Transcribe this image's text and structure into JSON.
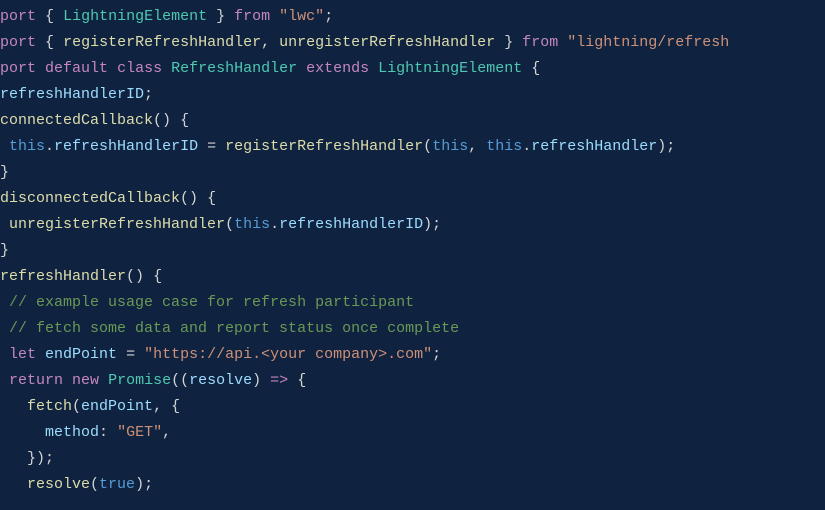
{
  "kw": {
    "import": "port",
    "from": "from",
    "default": "default",
    "class": "class",
    "extends": "extends",
    "let": "let",
    "return": "return",
    "new": "new"
  },
  "types": {
    "LightningElement": "LightningElement",
    "RefreshHandler": "RefreshHandler",
    "Promise": "Promise"
  },
  "strings": {
    "lwc": "\"lwc\"",
    "refreshSvc": "\"lightning/refresh",
    "endpoint": "\"https://api.<your company>.com\"",
    "get": "\"GET\""
  },
  "identifiers": {
    "registerRefreshHandler": "registerRefreshHandler",
    "unregisterRefreshHandler": "unregisterRefreshHandler",
    "refreshHandlerID": "refreshHandlerID",
    "connectedCallback": "connectedCallback",
    "disconnectedCallback": "disconnectedCallback",
    "refreshHandler": "refreshHandler",
    "endPoint": "endPoint",
    "resolve": "resolve",
    "fetch": "fetch",
    "method": "method"
  },
  "literals": {
    "this": "this",
    "true": "true"
  },
  "comments": {
    "c1": "// example usage case for refresh participant",
    "c2": "// fetch some data and report status once complete"
  },
  "punct": {
    "obrace": "{",
    "cbrace": "}",
    "oparen": "(",
    "cparen": ")",
    "comma": ",",
    "semi": ";",
    "dot": ".",
    "eq": "=",
    "arrow": "=>",
    "colon": ":",
    "cbraceParen": "});",
    "cparenSemi": ");",
    "space": " "
  },
  "indent": {
    "i0": "",
    "i1": " ",
    "i2": "  ",
    "i3": "   ",
    "i4": "    ",
    "i5": "     "
  }
}
